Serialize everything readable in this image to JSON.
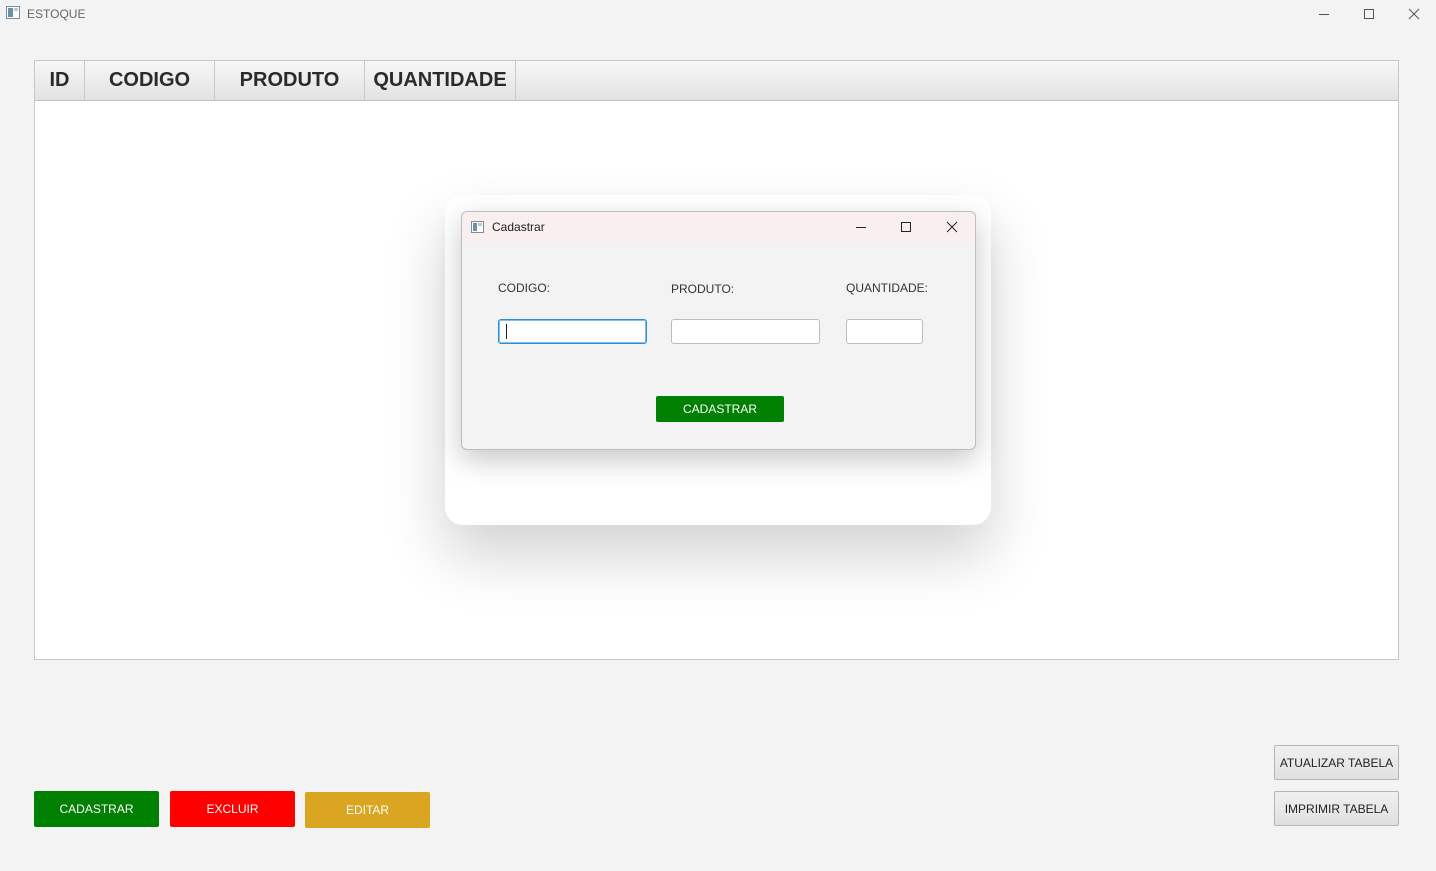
{
  "window": {
    "title": "ESTOQUE",
    "icon": "app-window-icon",
    "controls": [
      "minimize-icon",
      "maximize-icon",
      "close-icon"
    ]
  },
  "table": {
    "columns": [
      "ID",
      "CODIGO",
      "PRODUTO",
      "QUANTIDADE"
    ],
    "rows": []
  },
  "dialog": {
    "title": "Cadastrar",
    "fields": {
      "codigo": {
        "label": "CODIGO:",
        "value": ""
      },
      "produto": {
        "label": "PRODUTO:",
        "value": ""
      },
      "quantidade": {
        "label": "QUANTIDADE:",
        "value": ""
      }
    },
    "submit_label": "CADASTRAR"
  },
  "actions": {
    "cadastrar": "CADASTRAR",
    "excluir": "EXCLUIR",
    "editar": "EDITAR",
    "atualizar": "ATUALIZAR TABELA",
    "imprimir": "IMPRIMIR TABELA"
  },
  "colors": {
    "green": "#008000",
    "red": "#ff0000",
    "gold": "#daa520",
    "focus": "#2a8fd6"
  }
}
